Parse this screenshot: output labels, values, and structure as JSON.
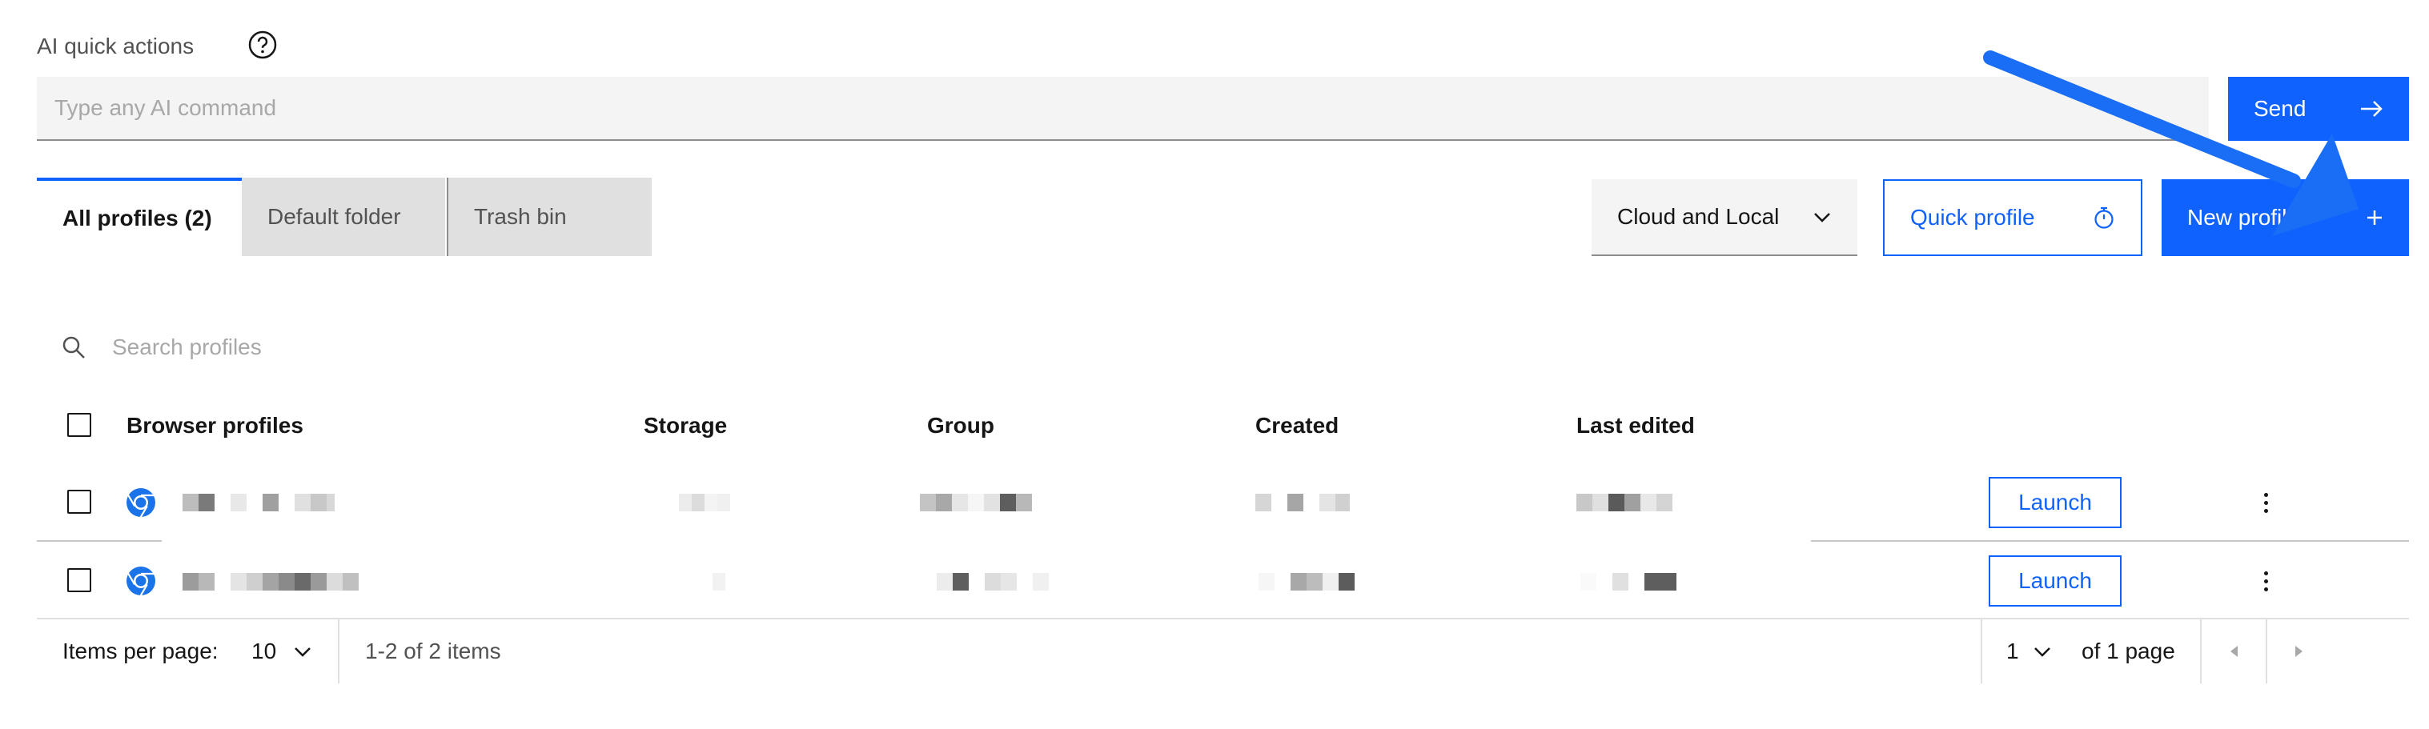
{
  "ai": {
    "label": "AI quick actions",
    "placeholder": "Type any AI command",
    "send_label": "Send"
  },
  "tabs": [
    {
      "label": "All profiles (2)"
    },
    {
      "label": "Default folder"
    },
    {
      "label": "Trash bin"
    }
  ],
  "toolbar": {
    "location_value": "Cloud and Local",
    "quick_profile_label": "Quick profile",
    "new_profile_label": "New profile"
  },
  "search": {
    "placeholder": "Search profiles"
  },
  "table": {
    "headers": [
      "Browser profiles",
      "Storage",
      "Group",
      "Created",
      "Last edited"
    ],
    "rows": [
      {
        "launch_label": "Launch"
      },
      {
        "launch_label": "Launch"
      }
    ]
  },
  "pagination": {
    "items_per_page_label": "Items per page:",
    "items_per_page_value": "10",
    "range_text": "1-2 of 2 items",
    "page_value": "1",
    "of_pages_text": "of 1 page"
  },
  "colors": {
    "accent": "#0f62fe",
    "annotation_arrow": "#1a6ef5"
  }
}
